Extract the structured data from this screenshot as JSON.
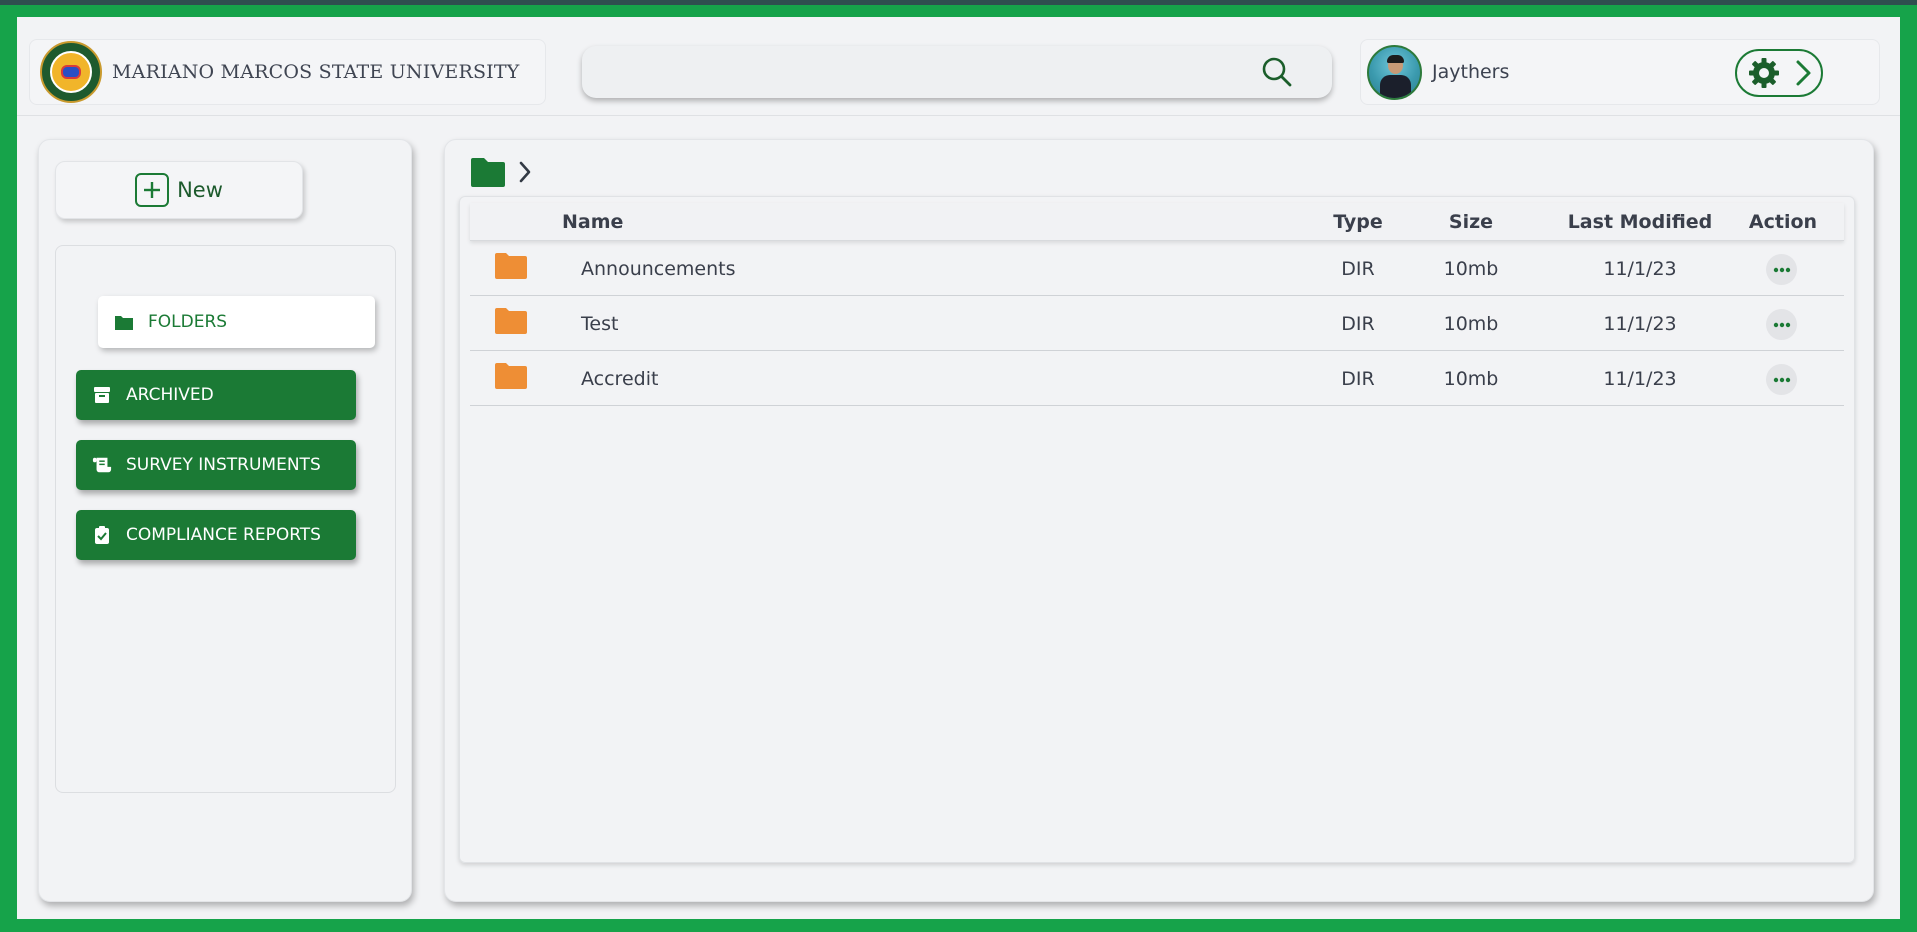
{
  "header": {
    "university_name": "MARIANO MARCOS STATE UNIVERSITY",
    "logo_icon": "university-seal-icon",
    "search": {
      "value": "",
      "placeholder": "",
      "icon": "search-icon"
    },
    "user": {
      "name": "Jaythers",
      "avatar_icon": "user-avatar"
    },
    "settings_icon": "gear-icon",
    "expand_icon": "chevron-right-icon"
  },
  "sidebar": {
    "new_label": "New",
    "items": [
      {
        "label": "FOLDERS",
        "icon": "folder-icon",
        "active": true
      },
      {
        "label": "ARCHIVED",
        "icon": "archive-icon",
        "active": false
      },
      {
        "label": "SURVEY INSTRUMENTS",
        "icon": "scroll-icon",
        "active": false
      },
      {
        "label": "COMPLIANCE REPORTS",
        "icon": "clipboard-check-icon",
        "active": false
      }
    ]
  },
  "main": {
    "breadcrumb": {
      "root_icon": "folder-icon",
      "separator_icon": "chevron-right-icon"
    },
    "table": {
      "columns": [
        "Name",
        "Type",
        "Size",
        "Last Modified",
        "Action"
      ],
      "rows": [
        {
          "name": "Announcements",
          "type": "DIR",
          "size": "10mb",
          "modified": "11/1/23"
        },
        {
          "name": "Test",
          "type": "DIR",
          "size": "10mb",
          "modified": "11/1/23"
        },
        {
          "name": "Accredit",
          "type": "DIR",
          "size": "10mb",
          "modified": "11/1/23"
        }
      ]
    }
  },
  "colors": {
    "brand_green": "#1b7a35",
    "background_green": "#16a34a",
    "folder_orange": "#ee8e35",
    "panel": "#f2f3f5"
  }
}
